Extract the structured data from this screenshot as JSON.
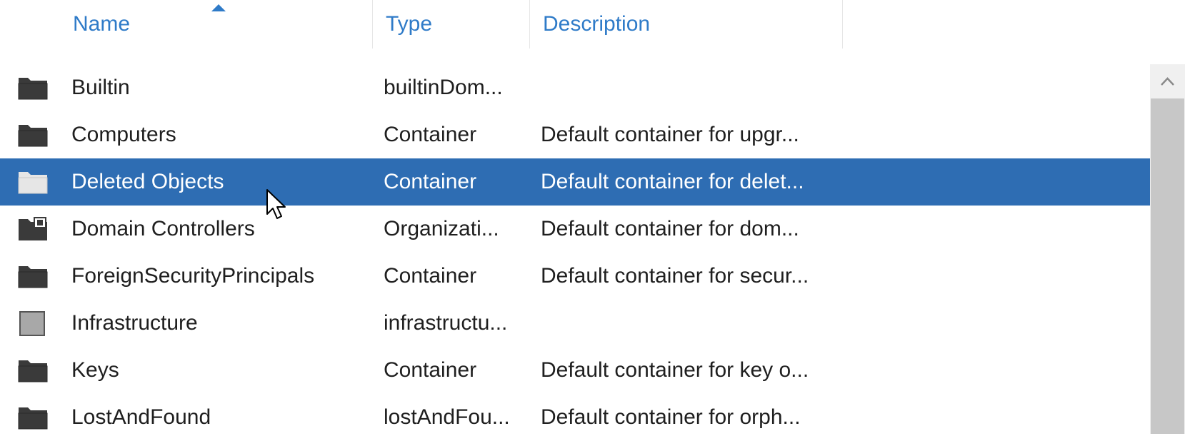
{
  "columns": {
    "name": "Name",
    "type": "Type",
    "description": "Description"
  },
  "sort": {
    "column": "name",
    "direction": "ascending"
  },
  "rows": [
    {
      "icon": "folder-icon",
      "name": "Builtin",
      "type": "builtinDom...",
      "description": ""
    },
    {
      "icon": "folder-icon",
      "name": "Computers",
      "type": "Container",
      "description": "Default container for upgr..."
    },
    {
      "icon": "folder-icon",
      "name": "Deleted Objects",
      "type": "Container",
      "description": "Default container for delet...",
      "selected": true
    },
    {
      "icon": "organizational-unit-icon",
      "name": "Domain Controllers",
      "type": "Organizati...",
      "description": "Default container for dom..."
    },
    {
      "icon": "folder-icon",
      "name": "ForeignSecurityPrincipals",
      "type": "Container",
      "description": "Default container for secur..."
    },
    {
      "icon": "generic-object-icon",
      "name": "Infrastructure",
      "type": "infrastructu...",
      "description": ""
    },
    {
      "icon": "folder-icon",
      "name": "Keys",
      "type": "Container",
      "description": "Default container for key o..."
    },
    {
      "icon": "folder-icon",
      "name": "LostAndFound",
      "type": "lostAndFou...",
      "description": "Default container for orph..."
    }
  ],
  "colors": {
    "header_text": "#2f7bc8",
    "selection_bg": "#2e6db3",
    "icon_dark": "#3a3a3a",
    "icon_gray": "#a8a8a8"
  }
}
